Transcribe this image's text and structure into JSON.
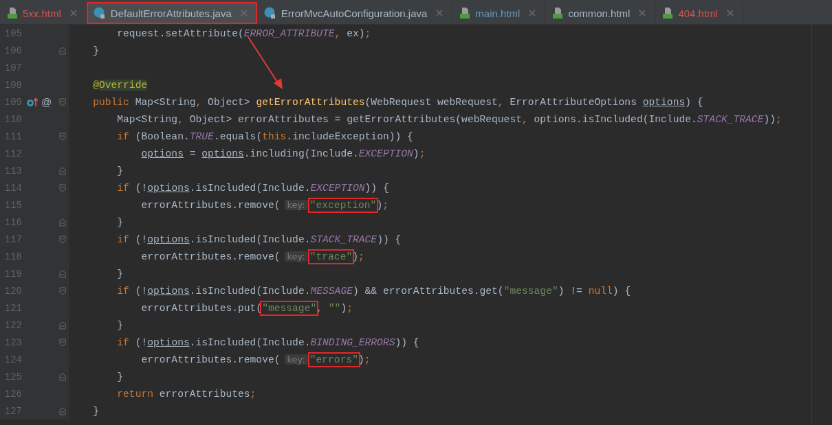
{
  "tabs": [
    {
      "label": "5xx.html",
      "kind": "html",
      "color": "#d25252",
      "selected": false,
      "highlighted": false
    },
    {
      "label": "DefaultErrorAttributes.java",
      "kind": "java",
      "color": "#a9b7c6",
      "selected": true,
      "highlighted": true
    },
    {
      "label": "ErrorMvcAutoConfiguration.java",
      "kind": "java",
      "color": "#a9b7c6",
      "selected": false,
      "highlighted": false
    },
    {
      "label": "main.html",
      "kind": "html",
      "color": "#6897bb",
      "selected": false,
      "highlighted": false
    },
    {
      "label": "common.html",
      "kind": "html",
      "color": "#a9b7c6",
      "selected": false,
      "highlighted": false
    },
    {
      "label": "404.html",
      "kind": "html",
      "color": "#d25252",
      "selected": false,
      "highlighted": false
    }
  ],
  "editor": {
    "lines": [
      {
        "number": "105",
        "fold_start": false,
        "fold_end": false,
        "override": false,
        "tokens": [
          {
            "kind": "plain",
            "text": "        request.setAttribute("
          },
          {
            "kind": "const",
            "text": "ERROR_ATTRIBUTE"
          },
          {
            "kind": "punct",
            "text": ","
          },
          {
            "kind": "plain",
            "text": " ex)"
          },
          {
            "kind": "punct",
            "text": ";"
          }
        ]
      },
      {
        "number": "106",
        "fold_start": false,
        "fold_end": true,
        "override": false,
        "tokens": [
          {
            "kind": "plain",
            "text": "    }"
          }
        ]
      },
      {
        "number": "107",
        "fold_start": false,
        "fold_end": false,
        "override": false
      },
      {
        "number": "108",
        "fold_start": false,
        "fold_end": false,
        "override": false,
        "tokens": [
          {
            "kind": "annotation",
            "text": "    @"
          },
          {
            "kind": "usage",
            "text": "Override"
          }
        ]
      },
      {
        "number": "109",
        "fold_start": true,
        "fold_end": false,
        "override": true,
        "gutter_mark": "@",
        "tokens": [
          {
            "kind": "keyword",
            "text": "    public "
          },
          {
            "kind": "plain",
            "text": "Map<String"
          },
          {
            "kind": "punct",
            "text": ","
          },
          {
            "kind": "plain",
            "text": " Object> "
          },
          {
            "kind": "method",
            "text": "getErrorAttributes"
          },
          {
            "kind": "plain",
            "text": "(WebRequest webRequest"
          },
          {
            "kind": "punct",
            "text": ","
          },
          {
            "kind": "plain",
            "text": " ErrorAttributeOptions "
          },
          {
            "kind": "underlined",
            "text": "options"
          },
          {
            "kind": "plain",
            "text": ") {"
          }
        ]
      },
      {
        "number": "110",
        "fold_start": false,
        "fold_end": false,
        "override": false,
        "tokens": [
          {
            "kind": "plain",
            "text": "        Map<String"
          },
          {
            "kind": "punct",
            "text": ","
          },
          {
            "kind": "plain",
            "text": " Object> errorAttributes = getErrorAttributes(webRequest"
          },
          {
            "kind": "punct",
            "text": ","
          },
          {
            "kind": "plain",
            "text": " options.isIncluded(Include."
          },
          {
            "kind": "const",
            "text": "STACK_TRACE"
          },
          {
            "kind": "plain",
            "text": "))"
          },
          {
            "kind": "punct",
            "text": ";"
          }
        ]
      },
      {
        "number": "111",
        "fold_start": true,
        "fold_end": false,
        "override": false,
        "tokens": [
          {
            "kind": "keyword",
            "text": "        if "
          },
          {
            "kind": "plain",
            "text": "(Boolean."
          },
          {
            "kind": "const",
            "text": "TRUE"
          },
          {
            "kind": "plain",
            "text": ".equals("
          },
          {
            "kind": "keyword",
            "text": "this"
          },
          {
            "kind": "plain",
            "text": ".includeException)) {"
          }
        ]
      },
      {
        "number": "112",
        "fold_start": false,
        "fold_end": false,
        "override": false,
        "tokens": [
          {
            "kind": "underlined",
            "text": "            options"
          },
          {
            "kind": "plain",
            "text": " = "
          },
          {
            "kind": "underlined",
            "text": "options"
          },
          {
            "kind": "plain",
            "text": ".including(Include."
          },
          {
            "kind": "const",
            "text": "EXCEPTION"
          },
          {
            "kind": "plain",
            "text": ")"
          },
          {
            "kind": "punct",
            "text": ";"
          }
        ]
      },
      {
        "number": "113",
        "fold_start": false,
        "fold_end": true,
        "override": false,
        "tokens": [
          {
            "kind": "plain",
            "text": "        }"
          }
        ]
      },
      {
        "number": "114",
        "fold_start": true,
        "fold_end": false,
        "override": false,
        "tokens": [
          {
            "kind": "keyword",
            "text": "        if "
          },
          {
            "kind": "plain",
            "text": "(!"
          },
          {
            "kind": "underlined",
            "text": "options"
          },
          {
            "kind": "plain",
            "text": ".isIncluded(Include."
          },
          {
            "kind": "const",
            "text": "EXCEPTION"
          },
          {
            "kind": "plain",
            "text": ")) {"
          }
        ]
      },
      {
        "number": "115",
        "fold_start": false,
        "fold_end": false,
        "override": false,
        "tokens": [
          {
            "kind": "plain",
            "text": "            errorAttributes.remove("
          },
          {
            "kind": "hint",
            "text": "key:"
          },
          {
            "kind": "string",
            "text": "\"exception\"",
            "highlighted": true
          },
          {
            "kind": "plain",
            "text": ")"
          },
          {
            "kind": "punct",
            "text": ";"
          }
        ]
      },
      {
        "number": "116",
        "fold_start": false,
        "fold_end": true,
        "override": false,
        "tokens": [
          {
            "kind": "plain",
            "text": "        }"
          }
        ]
      },
      {
        "number": "117",
        "fold_start": true,
        "fold_end": false,
        "override": false,
        "tokens": [
          {
            "kind": "keyword",
            "text": "        if "
          },
          {
            "kind": "plain",
            "text": "(!"
          },
          {
            "kind": "underlined",
            "text": "options"
          },
          {
            "kind": "plain",
            "text": ".isIncluded(Include."
          },
          {
            "kind": "const",
            "text": "STACK_TRACE"
          },
          {
            "kind": "plain",
            "text": ")) {"
          }
        ]
      },
      {
        "number": "118",
        "fold_start": false,
        "fold_end": false,
        "override": false,
        "tokens": [
          {
            "kind": "plain",
            "text": "            errorAttributes.remove("
          },
          {
            "kind": "hint",
            "text": "key:"
          },
          {
            "kind": "string",
            "text": "\"trace\"",
            "highlighted": true
          },
          {
            "kind": "plain",
            "text": ")"
          },
          {
            "kind": "punct",
            "text": ";"
          }
        ]
      },
      {
        "number": "119",
        "fold_start": false,
        "fold_end": true,
        "override": false,
        "tokens": [
          {
            "kind": "plain",
            "text": "        }"
          }
        ]
      },
      {
        "number": "120",
        "fold_start": true,
        "fold_end": false,
        "override": false,
        "tokens": [
          {
            "kind": "keyword",
            "text": "        if "
          },
          {
            "kind": "plain",
            "text": "(!"
          },
          {
            "kind": "underlined",
            "text": "options"
          },
          {
            "kind": "plain",
            "text": ".isIncluded(Include."
          },
          {
            "kind": "const",
            "text": "MESSAGE"
          },
          {
            "kind": "plain",
            "text": ") && errorAttributes.get("
          },
          {
            "kind": "string",
            "text": "\"message\""
          },
          {
            "kind": "plain",
            "text": ") != "
          },
          {
            "kind": "keyword",
            "text": "null"
          },
          {
            "kind": "plain",
            "text": ") {"
          }
        ]
      },
      {
        "number": "121",
        "fold_start": false,
        "fold_end": false,
        "override": false,
        "tokens": [
          {
            "kind": "plain",
            "text": "            errorAttributes.put("
          },
          {
            "kind": "string",
            "text": "\"message\"",
            "highlighted": true
          },
          {
            "kind": "punct",
            "text": ","
          },
          {
            "kind": "string",
            "text": " \"\""
          },
          {
            "kind": "plain",
            "text": ")"
          },
          {
            "kind": "punct",
            "text": ";"
          }
        ]
      },
      {
        "number": "122",
        "fold_start": false,
        "fold_end": true,
        "override": false,
        "tokens": [
          {
            "kind": "plain",
            "text": "        }"
          }
        ]
      },
      {
        "number": "123",
        "fold_start": true,
        "fold_end": false,
        "override": false,
        "tokens": [
          {
            "kind": "keyword",
            "text": "        if "
          },
          {
            "kind": "plain",
            "text": "(!"
          },
          {
            "kind": "underlined",
            "text": "options"
          },
          {
            "kind": "plain",
            "text": ".isIncluded(Include."
          },
          {
            "kind": "const",
            "text": "BINDING_ERRORS"
          },
          {
            "kind": "plain",
            "text": ")) {"
          }
        ]
      },
      {
        "number": "124",
        "fold_start": false,
        "fold_end": false,
        "override": false,
        "tokens": [
          {
            "kind": "plain",
            "text": "            errorAttributes.remove("
          },
          {
            "kind": "hint",
            "text": "key:"
          },
          {
            "kind": "string",
            "text": "\"errors\"",
            "highlighted": true
          },
          {
            "kind": "plain",
            "text": ")"
          },
          {
            "kind": "punct",
            "text": ";"
          }
        ]
      },
      {
        "number": "125",
        "fold_start": false,
        "fold_end": true,
        "override": false,
        "tokens": [
          {
            "kind": "plain",
            "text": "        }"
          }
        ]
      },
      {
        "number": "126",
        "fold_start": false,
        "fold_end": false,
        "override": false,
        "tokens": [
          {
            "kind": "keyword",
            "text": "        return "
          },
          {
            "kind": "plain",
            "text": "errorAttributes"
          },
          {
            "kind": "punct",
            "text": ";"
          }
        ]
      },
      {
        "number": "127",
        "fold_start": false,
        "fold_end": true,
        "override": false,
        "tokens": [
          {
            "kind": "plain",
            "text": "    }"
          }
        ]
      }
    ]
  }
}
